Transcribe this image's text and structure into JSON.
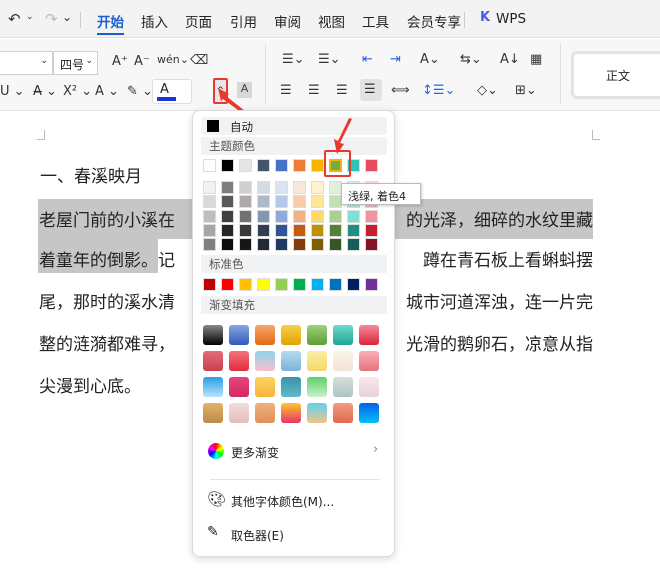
{
  "topbar": {
    "tabs": [
      "开始",
      "插入",
      "页面",
      "引用",
      "审阅",
      "视图",
      "工具",
      "会员专享"
    ],
    "active": 0,
    "brand": "WPS"
  },
  "ribbon": {
    "font_size": "四号",
    "style_preview": "正文",
    "phonetic": "wén",
    "color_accent": "#1a34d8"
  },
  "document": {
    "heading": "一、春溪映月",
    "lines": [
      {
        "left": "老屋门前的小溪在",
        "right": "的光泽，细碎的水纹里藏"
      },
      {
        "left": "着童年的倒影。",
        "left2": "记",
        "right": "蹲在青石板上看蝌蚪摆"
      },
      {
        "left": "尾，那时的溪水清",
        "right": "城市河道浑浊，连一片完"
      },
      {
        "left": "整的涟漪都难寻，",
        "right": "光滑的鹅卵石，凉意从指"
      },
      {
        "left": "尖漫到心底。",
        "right": ""
      }
    ]
  },
  "color_menu": {
    "auto_label": "自动",
    "theme_label": "主题颜色",
    "theme_colors": [
      "#ffffff",
      "#000000",
      "#e6e6e6",
      "#44546a",
      "#4472c4",
      "#ed7d31",
      "#f4b400",
      "#70ad47",
      "#2ec4b6",
      "#e84a5f"
    ],
    "theme_shades": [
      [
        "#f2f2f2",
        "#7f7f7f",
        "#d0cece",
        "#d6dce4",
        "#dae3f3",
        "#fbe5d6",
        "#fff2cc",
        "#e2efda",
        "#d5f5f1",
        "#fadbe0"
      ],
      [
        "#d9d9d9",
        "#595959",
        "#aeaaaa",
        "#adb9ca",
        "#b4c7e7",
        "#f8cbad",
        "#ffe699",
        "#c5e0b4",
        "#abebe3",
        "#f5b7c1"
      ],
      [
        "#bfbfbf",
        "#404040",
        "#757171",
        "#8497b0",
        "#8faadc",
        "#f4b183",
        "#ffd966",
        "#a9d18e",
        "#80e0d5",
        "#f093a2"
      ],
      [
        "#a6a6a6",
        "#262626",
        "#3a3838",
        "#333f50",
        "#2f5597",
        "#c55a11",
        "#bf9000",
        "#538135",
        "#1f8f84",
        "#c81c33"
      ],
      [
        "#808080",
        "#0d0d0d",
        "#171616",
        "#222a35",
        "#203864",
        "#843c0c",
        "#7f6000",
        "#375623",
        "#155f58",
        "#851222"
      ]
    ],
    "standard_label": "标准色",
    "standard_colors": [
      "#c00000",
      "#ff0000",
      "#ffc000",
      "#ffff00",
      "#92d050",
      "#00b050",
      "#00b0f0",
      "#0070c0",
      "#002060",
      "#7030a0"
    ],
    "gradient_label": "渐变填充",
    "gradients": [
      [
        "#888,#000",
        "#8aa6e0,#2f5bbf",
        "#f5a66a,#e26a14",
        "#f7d04a,#e0a400",
        "#9fd07a,#5a9e32",
        "#6ed9cb,#1fa596",
        "#f58a9a,#d9243c"
      ],
      [
        "#e56b7a,#c8404f",
        "#f2727f,#e02c3e",
        "#8fd3ea,#f5c0d0",
        "#b6d9ef,#7ab3d9",
        "#fbeea0,#f4d96a",
        "#faf3ea,#f2e4d6",
        "#f9aeb7,#e5737f"
      ],
      [
        "#2c9de8,#b8e4fb",
        "#e64580,#d42a5e",
        "#fcd260,#f8b43c",
        "#3d92a8,#5dbac9",
        "#5fcf6a,#c9f0c9",
        "#d6e0dc,#aec4c3",
        "#f7e8ec,#e9d1d8"
      ],
      [
        "#e2b46a,#bc8a48",
        "#f2dcdc,#e6bcbc",
        "#f0b080,#e0905a",
        "#fcc72c,#e8336a",
        "#5fd1f0,#f1c587",
        "#f29c80,#e06850",
        "#0b5fe8,#00c0f8"
      ]
    ],
    "more_gradients": "更多渐变",
    "other_colors": "其他字体颜色(M)...",
    "eyedropper": "取色器(E)",
    "selected": "#70ad47"
  },
  "tooltip": "浅绿, 着色4",
  "annotation_color": "#e8392e"
}
